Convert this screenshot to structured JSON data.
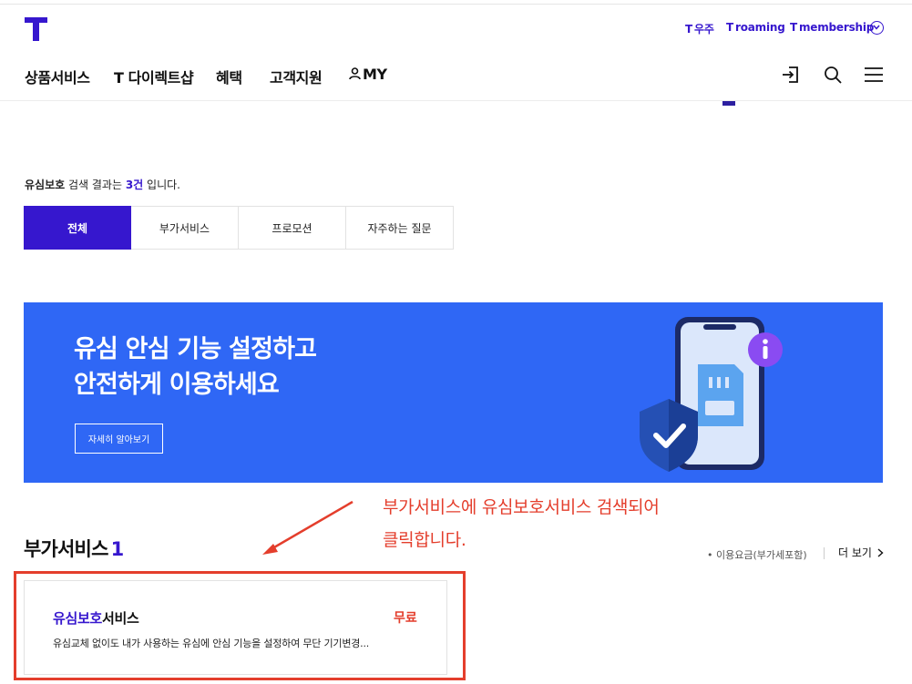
{
  "utility_links": [
    {
      "mark": "T",
      "label": "우주"
    },
    {
      "mark": "T",
      "label": "roaming"
    },
    {
      "mark": "T",
      "label": "membership"
    }
  ],
  "nav": {
    "items": [
      "상품서비스",
      "T 다이렉트샵",
      "혜택",
      "고객지원",
      "MY"
    ]
  },
  "search": {
    "keyword": "유심보호",
    "mid": " 검색 결과는 ",
    "count": "3건",
    "suffix": " 입니다."
  },
  "tabs": [
    {
      "label": "전체",
      "active": true
    },
    {
      "label": "부가서비스",
      "active": false
    },
    {
      "label": "프로모션",
      "active": false
    },
    {
      "label": "자주하는 질문",
      "active": false
    }
  ],
  "banner": {
    "line1": "유심 안심 기능 설정하고",
    "line2": "안전하게 이용하세요",
    "button": "자세히 알아보기",
    "bg_color": "#2f67f5"
  },
  "annotation": {
    "line1": "부가서비스에 유심보호서비스 검색되어",
    "line2": "클릭합니다.",
    "color": "#e43e2c"
  },
  "section": {
    "title": "부가서비스",
    "count": "1",
    "note": "• 이용요금(부가세포함)",
    "more": "더 보기"
  },
  "card": {
    "title_highlight": "유심보호",
    "title_rest": "서비스",
    "price": "무료",
    "desc": "유심교체 없이도 내가 사용하는 유심에 안심 기능을 설정하여 무단 기기변경..."
  },
  "colors": {
    "brand": "#3617ce",
    "accent_red": "#e43e2c"
  }
}
